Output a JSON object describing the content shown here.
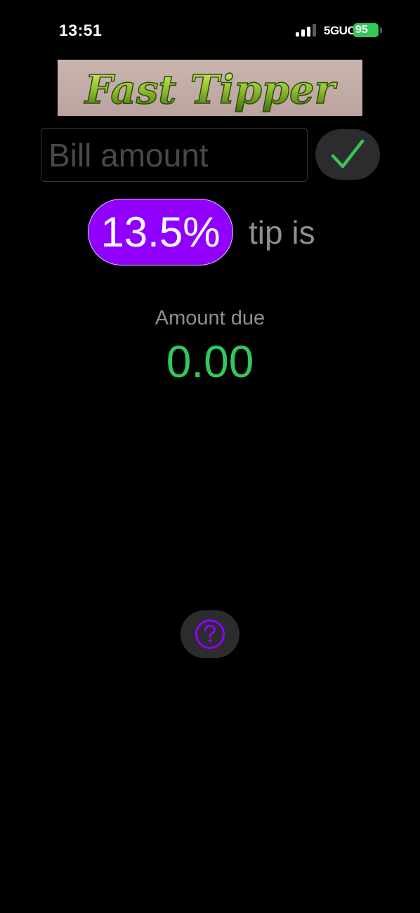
{
  "status_bar": {
    "time": "13:51",
    "network": "5GUC",
    "battery": "95",
    "battery_color": "#34c759"
  },
  "logo": {
    "text": "Fast Tipper"
  },
  "bill": {
    "placeholder": "Bill amount",
    "value": "",
    "confirm_icon": "checkmark-icon"
  },
  "tip": {
    "percent": "13.5%",
    "label": "tip is",
    "pill_color": "#9100ff"
  },
  "amount": {
    "label": "Amount due",
    "value": "0.00",
    "value_color": "#34c759"
  },
  "help": {
    "icon": "question-mark-icon"
  }
}
